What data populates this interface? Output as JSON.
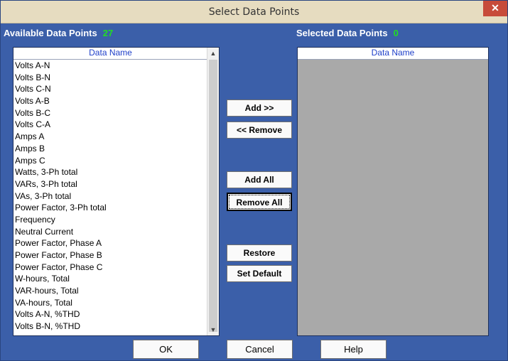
{
  "window": {
    "title": "Select Data Points",
    "close_symbol": "✕"
  },
  "available": {
    "label": "Available Data Points",
    "count": "27",
    "column_header": "Data Name",
    "items": [
      "Volts A-N",
      "Volts B-N",
      "Volts C-N",
      "Volts A-B",
      "Volts B-C",
      "Volts C-A",
      "Amps A",
      "Amps B",
      "Amps C",
      "Watts, 3-Ph total",
      "VARs, 3-Ph total",
      "VAs, 3-Ph total",
      "Power Factor, 3-Ph total",
      "Frequency",
      "Neutral Current",
      "Power Factor, Phase A",
      "Power Factor, Phase B",
      "Power Factor, Phase C",
      "W-hours, Total",
      "VAR-hours, Total",
      "VA-hours, Total",
      "Volts A-N, %THD",
      "Volts B-N, %THD"
    ]
  },
  "selected": {
    "label": "Selected Data Points",
    "count": "0",
    "column_header": "Data Name"
  },
  "buttons": {
    "add": "Add >>",
    "remove": "<< Remove",
    "add_all": "Add All",
    "remove_all": "Remove All",
    "restore": "Restore",
    "set_default": "Set Default",
    "ok": "OK",
    "cancel": "Cancel",
    "help": "Help"
  }
}
